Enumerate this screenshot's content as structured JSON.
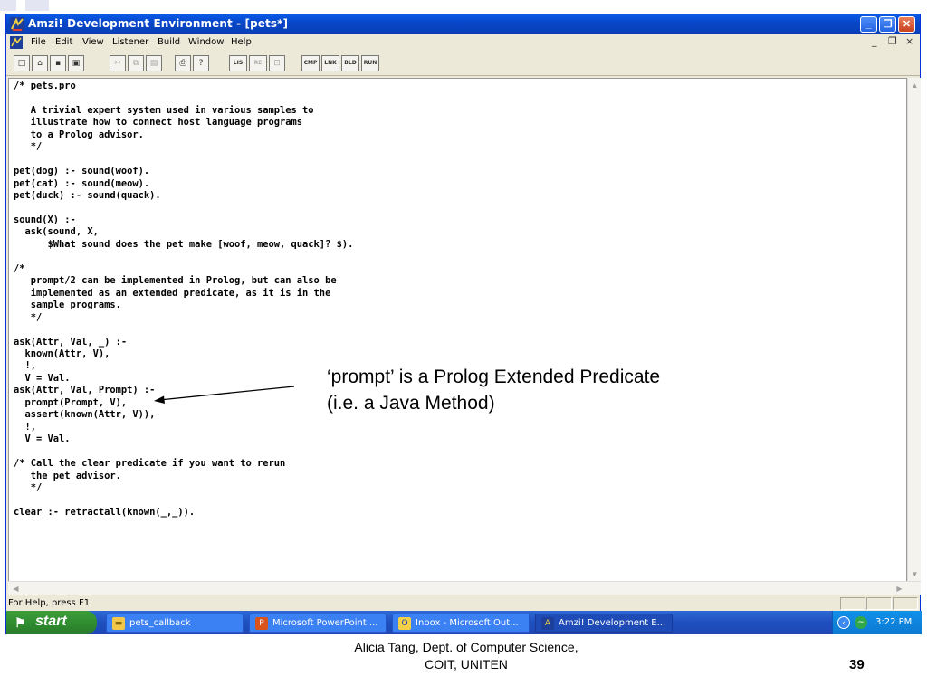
{
  "window": {
    "title": "Amzi! Development Environment - [pets*]",
    "minimize": "_",
    "maximize": "❐",
    "close": "✕"
  },
  "menubar": {
    "items": [
      "File",
      "Edit",
      "View",
      "Listener",
      "Build",
      "Window",
      "Help"
    ],
    "doc_controls": [
      "_",
      "❐",
      "×"
    ]
  },
  "toolbar": {
    "text_buttons": [
      "LIS",
      "RE",
      "CMP",
      "LNK",
      "BLD",
      "RUN"
    ]
  },
  "editor": {
    "code": "/* pets.pro\n\n   A trivial expert system used in various samples to\n   illustrate how to connect host language programs\n   to a Prolog advisor.\n   */\n\npet(dog) :- sound(woof).\npet(cat) :- sound(meow).\npet(duck) :- sound(quack).\n\nsound(X) :-\n  ask(sound, X,\n      $What sound does the pet make [woof, meow, quack]? $).\n\n/*\n   prompt/2 can be implemented in Prolog, but can also be\n   implemented as an extended predicate, as it is in the\n   sample programs.\n   */\n\nask(Attr, Val, _) :-\n  known(Attr, V),\n  !,\n  V = Val.\nask(Attr, Val, Prompt) :-\n  prompt(Prompt, V),\n  assert(known(Attr, V)),\n  !,\n  V = Val.\n\n/* Call the clear predicate if you want to rerun\n   the pet advisor.\n   */\n\nclear :- retractall(known(_,_))."
  },
  "statusbar": {
    "text": "For Help, press F1"
  },
  "taskbar": {
    "start_label": "start",
    "tasks": [
      {
        "label": "pets_callback",
        "icon": "folder-icon"
      },
      {
        "label": "Microsoft PowerPoint ...",
        "icon": "powerpoint-icon"
      },
      {
        "label": "Inbox - Microsoft Out...",
        "icon": "outlook-icon"
      },
      {
        "label": "Amzi! Development E...",
        "icon": "amzi-icon"
      }
    ],
    "clock": "3:22 PM"
  },
  "annotation": {
    "line1": "‘prompt’ is a Prolog Extended Predicate",
    "line2": "(i.e. a Java Method)"
  },
  "footer": {
    "line1": "Alicia Tang, Dept. of Computer Science,",
    "line2": "COIT, UNITEN",
    "page_number": "39"
  }
}
